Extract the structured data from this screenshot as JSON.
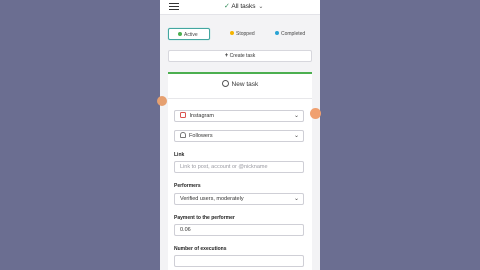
{
  "header": {
    "menu_icon": "hamburger-menu-icon",
    "tasks_filter": "All tasks",
    "tasks_filter_check": "✓",
    "tasks_filter_chevron": "⌄"
  },
  "filters": [
    {
      "label": "Active",
      "color": "#4caf50"
    },
    {
      "label": "Stopped",
      "color": "#f4b400"
    },
    {
      "label": "Completed",
      "color": "#29a3d4"
    }
  ],
  "create_task": {
    "plus": "+",
    "label": "Create task"
  },
  "new_task": {
    "title": "New task",
    "platform": {
      "value": "Instagram",
      "icon": "instagram-icon"
    },
    "service": {
      "value": "Followers",
      "icon": "user-icon"
    },
    "link": {
      "label": "Link",
      "placeholder": "Link to post, account or @nickname"
    },
    "performers": {
      "label": "Performers",
      "value": "Verified users, moderately"
    },
    "payment": {
      "label": "Payment to the performer",
      "value": "0.06"
    },
    "executions": {
      "label": "Number of executions"
    }
  },
  "colors": {
    "accent": "#4caf50",
    "active_border": "#43a6a0",
    "background": "#6b6e91"
  }
}
